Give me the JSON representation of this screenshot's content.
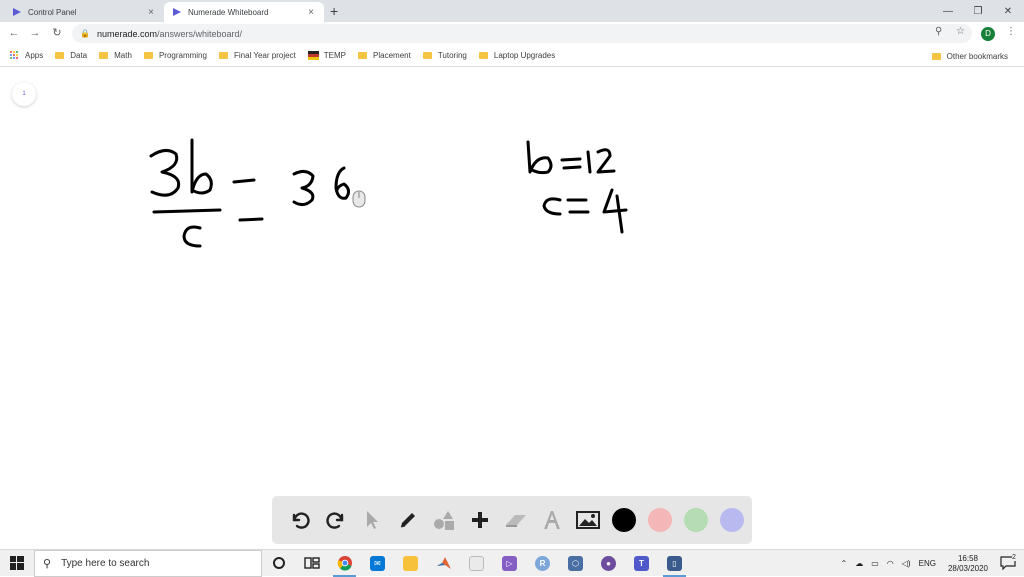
{
  "tabs": [
    {
      "label": "Control Panel",
      "close": "×"
    },
    {
      "label": "Numerade Whiteboard",
      "close": "×"
    }
  ],
  "new_tab": "+",
  "window_controls": {
    "minimize": "—",
    "maximize": "❐",
    "close": "✕"
  },
  "address_bar": {
    "url_host": "numerade.com",
    "url_path": "/answers/whiteboard/"
  },
  "profile_initial": "D",
  "bookmarks": [
    "Data",
    "Math",
    "Programming",
    "Final Year project",
    "TEMP",
    "Placement",
    "Tutoring",
    "Laptop Upgrades"
  ],
  "apps_label": "Apps",
  "other_bookmarks": "Other bookmarks",
  "whiteboard": {
    "page_number": "1"
  },
  "toolbar": {
    "tools": [
      "undo-icon",
      "redo-icon",
      "pointer-icon",
      "pen-icon",
      "shapes-icon",
      "plus-icon",
      "eraser-icon",
      "text-icon",
      "image-icon"
    ],
    "colors": [
      "#000000",
      "#f4b6b6",
      "#b5dcb5",
      "#b9b9f0"
    ]
  },
  "taskbar": {
    "search_placeholder": "Type here to search",
    "language": "ENG",
    "time": "16:58",
    "date": "28/03/2020",
    "notification_count": "2"
  }
}
